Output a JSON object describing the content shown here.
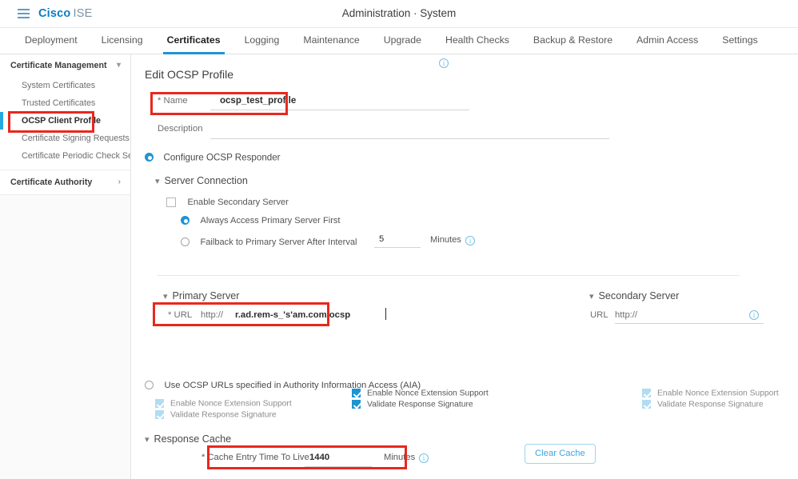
{
  "topbar": {
    "menu_icon": "hamburger-icon",
    "brand_primary": "Cisco",
    "brand_secondary": "ISE",
    "page_title": "Administration · System"
  },
  "tabs": [
    {
      "label": "Deployment",
      "active": false
    },
    {
      "label": "Licensing",
      "active": false
    },
    {
      "label": "Certificates",
      "active": true
    },
    {
      "label": "Logging",
      "active": false
    },
    {
      "label": "Maintenance",
      "active": false
    },
    {
      "label": "Upgrade",
      "active": false
    },
    {
      "label": "Health Checks",
      "active": false
    },
    {
      "label": "Backup & Restore",
      "active": false
    },
    {
      "label": "Admin Access",
      "active": false
    },
    {
      "label": "Settings",
      "active": false
    }
  ],
  "sidebar": {
    "groups": [
      {
        "title": "Certificate Management",
        "chevron": "chevron-down-icon",
        "items": [
          "System Certificates",
          "Trusted Certificates",
          "OCSP Client Profile",
          "Certificate Signing Requests",
          "Certificate Periodic Check Se..."
        ],
        "selected_index": 2
      },
      {
        "title": "Certificate Authority",
        "chevron": "chevron-right-icon",
        "items": []
      }
    ]
  },
  "main": {
    "form_title": "Edit OCSP Profile",
    "name": {
      "label": "* Name",
      "value": "ocsp_test_profile",
      "placeholder": ""
    },
    "description": {
      "label": "Description",
      "value": "",
      "placeholder": ""
    },
    "configure_responder": {
      "label": "Configure OCSP Responder",
      "selected": true
    },
    "server_connection": {
      "title": "Server Connection",
      "chevron": "chevron-down-icon",
      "enable_secondary": {
        "label": "Enable Secondary Server",
        "checked": false
      },
      "always_access_primary": {
        "label": "Always Access Primary Server First",
        "selected": true
      },
      "failback": {
        "label": "Failback to Primary Server After Interval",
        "selected": false,
        "value": "5",
        "unit": "Minutes",
        "info": "info-icon"
      }
    },
    "primary_server": {
      "title": "Primary Server",
      "chevron": "chevron-down-icon",
      "url_label": "* URL",
      "url_scheme": "http://",
      "url_value": "r.ad.rem-s_'s'am.com/ocsp",
      "info": "info-icon",
      "checks": [
        {
          "label": "Enable Nonce Extension Support",
          "checked": true,
          "enabled": true
        },
        {
          "label": "Validate Response Signature",
          "checked": true,
          "enabled": true
        }
      ]
    },
    "secondary_server": {
      "title": "Secondary Server",
      "chevron": "chevron-down-icon",
      "url_label": "URL",
      "url_scheme": "http://",
      "url_value": "",
      "info": "info-icon",
      "checks": [
        {
          "label": "Enable Nonce Extension Support",
          "checked": true,
          "enabled": false
        },
        {
          "label": "Validate Response Signature",
          "checked": true,
          "enabled": false
        }
      ]
    },
    "aia": {
      "label": "Use OCSP URLs specified in Authority Information Access (AIA)",
      "selected": false,
      "checks": [
        {
          "label": "Enable Nonce Extension Support",
          "checked": true,
          "enabled": false
        },
        {
          "label": "Validate Response Signature",
          "checked": true,
          "enabled": false
        }
      ]
    },
    "response_cache": {
      "title": "Response Cache",
      "chevron": "chevron-down-icon",
      "ttl_label": "* Cache Entry Time To Live",
      "ttl_value": "1440",
      "unit": "Minutes",
      "info": "info-icon",
      "clear_cache_label": "Clear Cache"
    }
  },
  "annotations": {
    "color": "#e8281e",
    "boxes": [
      "sidebar-ocsp-client-profile",
      "name-field",
      "primary-server-url",
      "cache-entry-time-to-live"
    ]
  }
}
